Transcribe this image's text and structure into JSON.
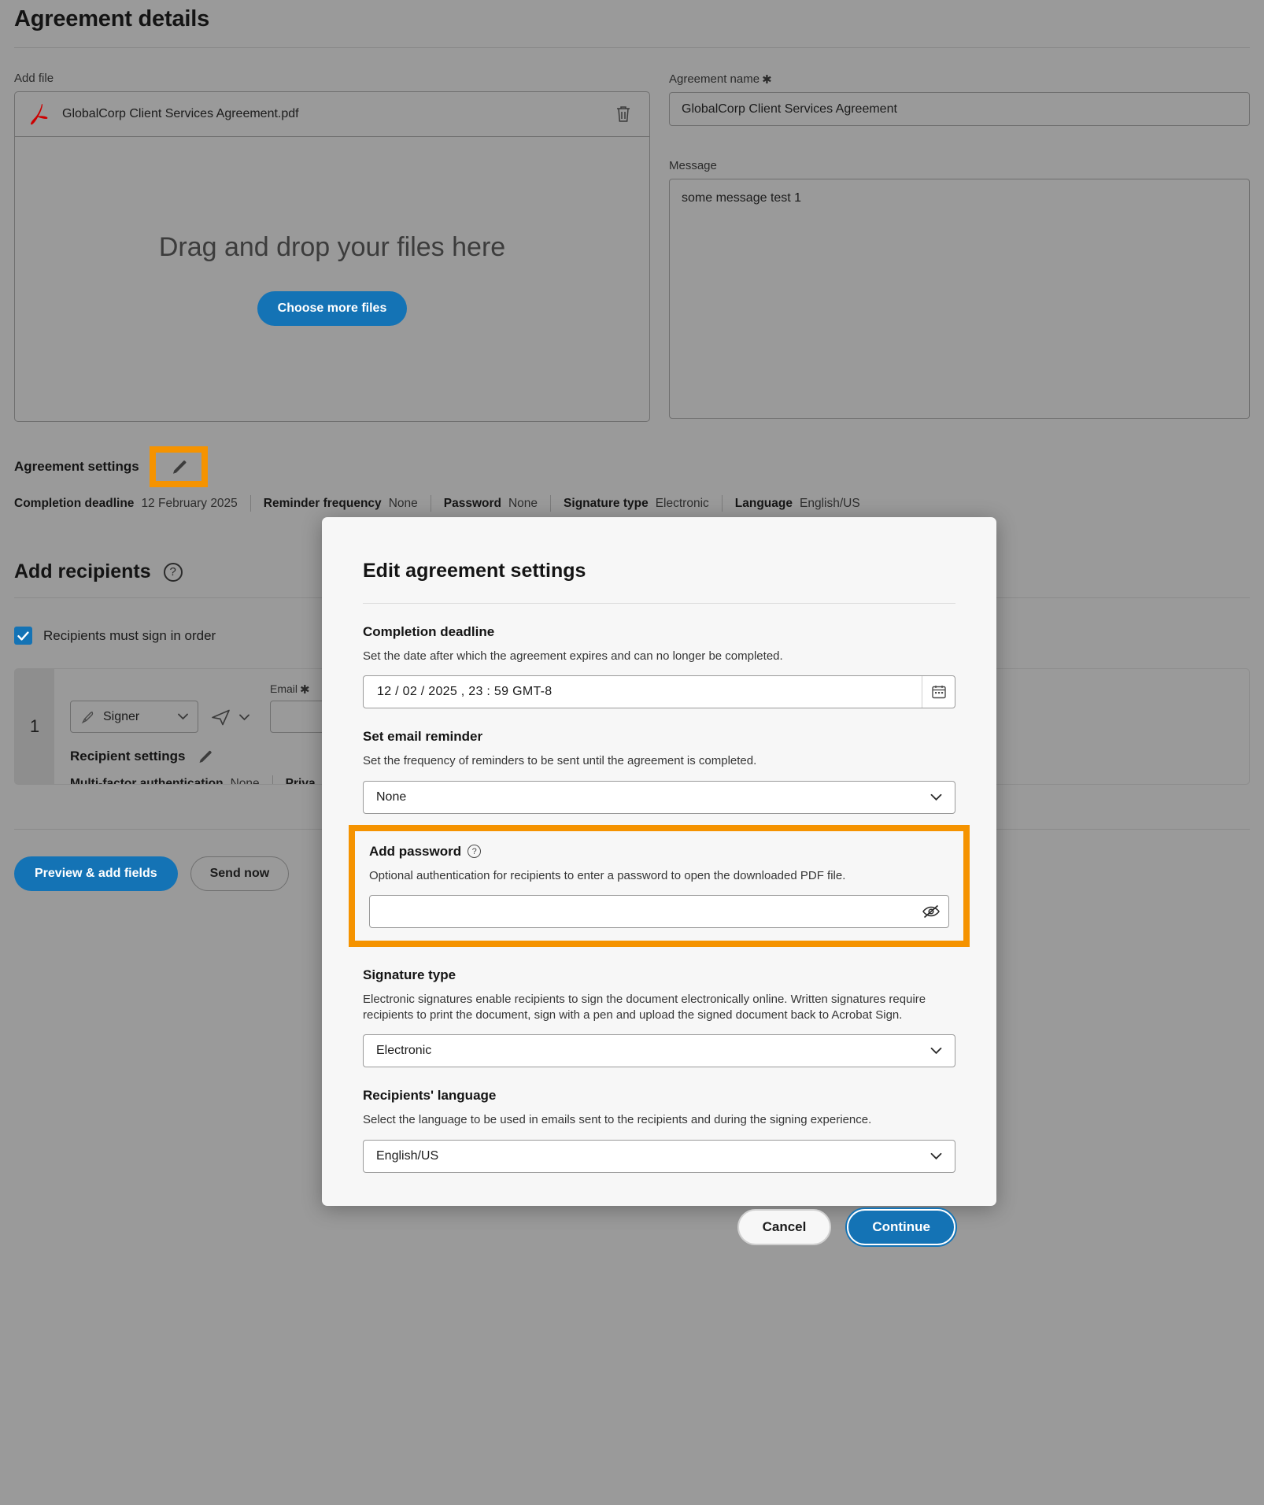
{
  "page": {
    "title": "Agreement details",
    "add_file_label": "Add file",
    "file": {
      "name": "GlobalCorp Client Services Agreement.pdf",
      "icon": "pdf-icon",
      "delete_icon": "trash-icon"
    },
    "dropzone": {
      "text": "Drag and drop your files here",
      "button": "Choose more files"
    },
    "agreement_name": {
      "label": "Agreement name",
      "required_mark": "✱",
      "value": "GlobalCorp Client Services Agreement"
    },
    "message": {
      "label": "Message",
      "value": "some message test 1"
    },
    "agreement_settings": {
      "label": "Agreement settings",
      "edit_icon": "pencil-icon",
      "summary": [
        {
          "key": "Completion deadline",
          "value": "12 February 2025"
        },
        {
          "key": "Reminder frequency",
          "value": "None"
        },
        {
          "key": "Password",
          "value": "None"
        },
        {
          "key": "Signature type",
          "value": "Electronic"
        },
        {
          "key": "Language",
          "value": "English/US"
        }
      ]
    },
    "recipients": {
      "title": "Add recipients",
      "help_icon": "help-icon",
      "sign_in_order_label": "Recipients must sign in order",
      "sign_in_order_checked": true,
      "row": {
        "index": "1",
        "role": "Signer",
        "role_icon": "pen-icon",
        "send_icon": "paper-plane-icon",
        "email_label": "Email",
        "email_required_mark": "✱",
        "email_value": "",
        "settings_label": "Recipient settings",
        "settings_edit_icon": "pencil-icon",
        "summary": [
          {
            "key": "Multi-factor authentication",
            "value": "None"
          },
          {
            "key": "Priva",
            "value": ""
          }
        ]
      }
    },
    "footer": {
      "preview_button": "Preview & add fields",
      "send_button": "Send now"
    }
  },
  "modal": {
    "title": "Edit agreement settings",
    "completion_deadline": {
      "heading": "Completion deadline",
      "description": "Set the date after which the agreement expires and can no longer be completed.",
      "value": "12 /   02 / 2025 ,  23 : 59   GMT-8",
      "calendar_icon": "calendar-icon"
    },
    "email_reminder": {
      "heading": "Set email reminder",
      "description": "Set the frequency of reminders to be sent until the agreement is completed.",
      "value": "None",
      "chevron_icon": "chevron-down-icon"
    },
    "add_password": {
      "heading": "Add password",
      "help_icon": "help-icon",
      "description": "Optional authentication for recipients to enter a password to open the downloaded PDF file.",
      "value": "",
      "placeholder": "",
      "toggle_icon": "eye-off-icon",
      "highlight_color": "#f59300"
    },
    "signature_type": {
      "heading": "Signature type",
      "description": "Electronic signatures enable recipients to sign the document electronically online. Written signatures require recipients to print the document, sign with a pen and upload the signed document back to Acrobat Sign.",
      "value": "Electronic",
      "chevron_icon": "chevron-down-icon"
    },
    "recipients_language": {
      "heading": "Recipients' language",
      "description": "Select the language to be used in emails sent to the recipients and during the signing experience.",
      "value": "English/US",
      "chevron_icon": "chevron-down-icon"
    },
    "actions": {
      "cancel": "Cancel",
      "continue": "Continue"
    }
  },
  "colors": {
    "accent_blue": "#1473b5",
    "highlight_orange": "#f59300",
    "page_backdrop": "#9a9a9a",
    "modal_bg": "#f7f7f7"
  }
}
